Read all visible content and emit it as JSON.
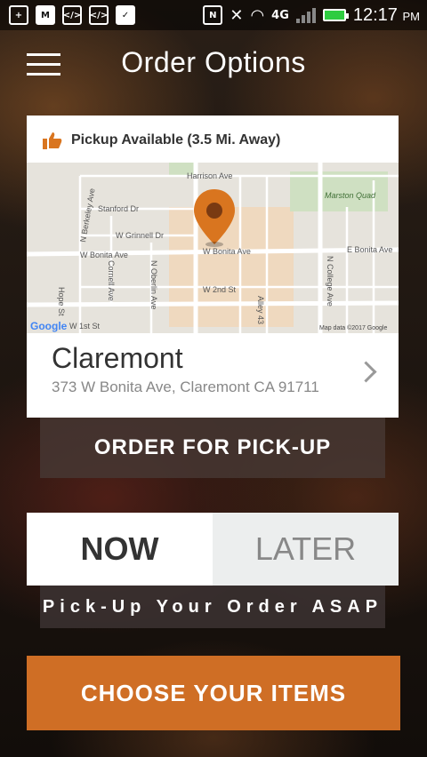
{
  "status_bar": {
    "time": "12:17",
    "ampm": "PM",
    "network": "4G"
  },
  "header": {
    "title": "Order Options"
  },
  "location_card": {
    "pickup_label": "Pickup Available (3.5 Mi. Away)",
    "name": "Claremont",
    "address": "373 W Bonita Ave, Claremont CA 91711",
    "map": {
      "streets": [
        "Harrison Ave",
        "Stanford Dr",
        "W Grinnell Dr",
        "W Bonita Ave",
        "W Bonita Ave",
        "E Bonita Ave",
        "W 2nd St",
        "W 1st St",
        "N Berkeley Ave",
        "Cornell Ave",
        "N Oberlin Ave",
        "Alley 43",
        "N College Ave",
        "Hope St",
        "Marston Quad"
      ],
      "brand": "Google",
      "attribution": "Map data ©2017 Google"
    }
  },
  "order_for_pickup": "ORDER FOR PICK-UP",
  "timing": {
    "now_label": "NOW",
    "later_label": "LATER",
    "selected": "NOW",
    "note": "Pick-Up Your Order ASAP"
  },
  "choose_items": "CHOOSE YOUR ITEMS",
  "colors": {
    "accent": "#cf6e25",
    "pin": "#d9751f"
  }
}
